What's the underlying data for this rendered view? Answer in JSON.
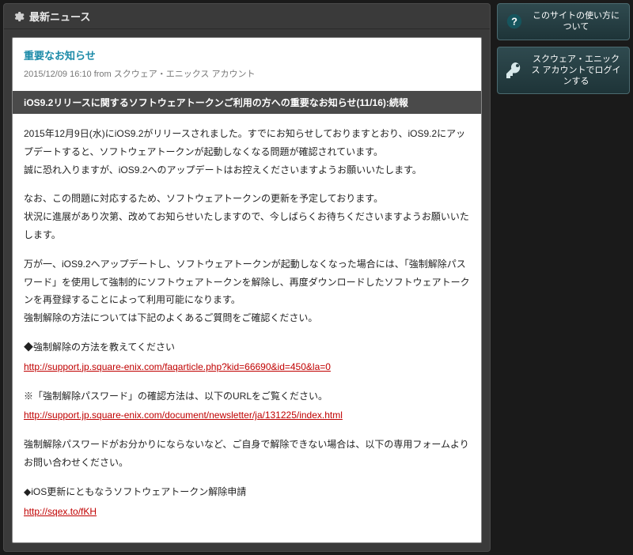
{
  "header": {
    "title": "最新ニュース"
  },
  "sidebar": {
    "help_label": "このサイトの使い方について",
    "login_label": "スクウェア・エニックス アカウントでログインする"
  },
  "article": {
    "title": "重要なお知らせ",
    "date_line": "2015/12/09 16:10 from スクウェア・エニックス アカウント",
    "banner": "iOS9.2リリースに関するソフトウェアトークンご利用の方への重要なお知らせ(11/16):続報",
    "p1": "2015年12月9日(水)にiOS9.2がリリースされました。すでにお知らせしておりますとおり、iOS9.2にアップデートすると、ソフトウェアトークンが起動しなくなる問題が確認されています。\n誠に恐れ入りますが、iOS9.2へのアップデートはお控えくださいますようお願いいたします。",
    "p2": "なお、この問題に対応するため、ソフトウェアトークンの更新を予定しております。\n状況に進展があり次第、改めてお知らせいたしますので、今しばらくお待ちくださいますようお願いいたします。",
    "p3": "万が一、iOS9.2へアップデートし、ソフトウェアトークンが起動しなくなった場合には、「強制解除パスワード」を使用して強制的にソフトウェアトークンを解除し、再度ダウンロードしたソフトウェアトークンを再登録することによって利用可能になります。\n強制解除の方法については下記のよくあるご質問をご確認ください。",
    "sec1_heading": "◆強制解除の方法を教えてください",
    "sec1_link": "http://support.jp.square-enix.com/faqarticle.php?kid=66690&id=450&la=0",
    "p4": "※「強制解除パスワード」の確認方法は、以下のURLをご覧ください。",
    "sec2_link": "http://support.jp.square-enix.com/document/newsletter/ja/131225/index.html",
    "p5": "強制解除パスワードがお分かりにならないなど、ご自身で解除できない場合は、以下の専用フォームよりお問い合わせください。",
    "sec3_heading": "◆iOS更新にともなうソフトウェアトークン解除申請",
    "sec3_link": "http://sqex.to/fKH"
  }
}
